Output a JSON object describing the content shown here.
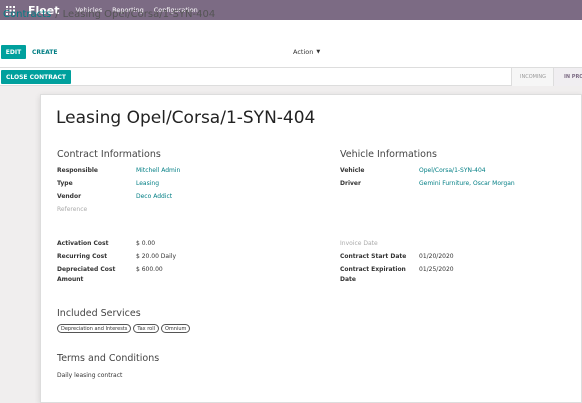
{
  "app": {
    "name": "Fleet",
    "grid_icon": "apps-grid-icon"
  },
  "menu": [
    "Vehicles",
    "Reporting",
    "Configuration"
  ],
  "breadcrumb": {
    "parent": "Contracts",
    "separator": "/",
    "current": "Leasing Opel/Corsa/1-SYN-404"
  },
  "toolbar": {
    "edit_label": "EDIT",
    "create_label": "CREATE",
    "action_label": "Action",
    "action_caret": "▼"
  },
  "statusbar": {
    "close_label": "CLOSE CONTRACT",
    "stages": [
      "INCOMING",
      "IN PROGRESS"
    ],
    "active_stage": "IN PROGRESS"
  },
  "form": {
    "title": "Leasing Opel/Corsa/1-SYN-404",
    "contract_section": "Contract Informations",
    "vehicle_section": "Vehicle Informations",
    "responsible_label": "Responsible",
    "responsible_value": "Mitchell Admin",
    "type_label": "Type",
    "type_value": "Leasing",
    "vendor_label": "Vendor",
    "vendor_value": "Deco Addict",
    "reference_label": "Reference",
    "vehicle_label": "Vehicle",
    "vehicle_value": "Opel/Corsa/1-SYN-404",
    "driver_label": "Driver",
    "driver_value": "Gemini Furniture, Oscar Morgan",
    "activation_cost_label": "Activation Cost",
    "activation_cost_value": "$ 0.00",
    "recurring_cost_label": "Recurring Cost",
    "recurring_cost_value": "$ 20.00 Daily",
    "depreciated_cost_label_1": "Depreciated Cost",
    "depreciated_cost_label_2": "Amount",
    "depreciated_cost_value": "$ 600.00",
    "invoice_date_label": "Invoice Date",
    "start_date_label": "Contract Start Date",
    "start_date_value": "01/20/2020",
    "expiration_date_label_1": "Contract Expiration",
    "expiration_date_label_2": "Date",
    "expiration_date_value": "01/25/2020",
    "services_section": "Included Services",
    "services": [
      "Depreciation and Interests",
      "Tax roll",
      "Omnium"
    ],
    "terms_section": "Terms and Conditions",
    "terms_text": "Daily leasing contract"
  },
  "colors": {
    "topbar": "#7c6b84",
    "primary": "#00a09d",
    "link": "#017e84"
  }
}
